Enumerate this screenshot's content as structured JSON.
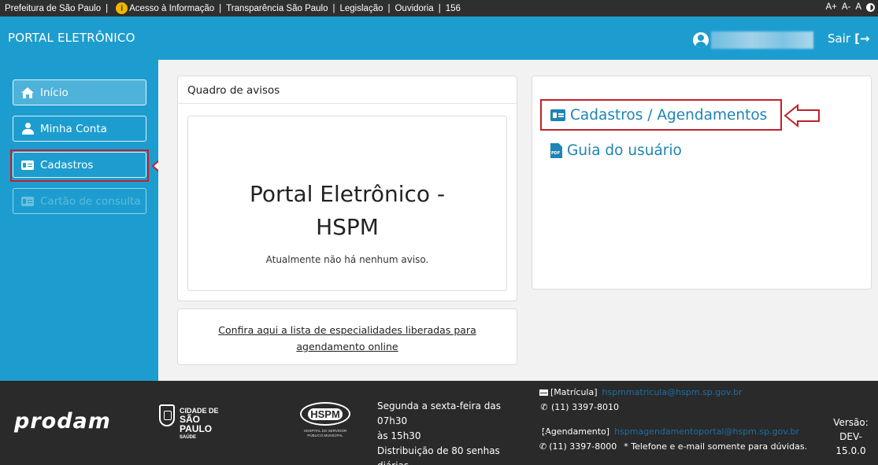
{
  "gov_bar": {
    "items": [
      "Prefeitura de São Paulo",
      "Acesso à Informação",
      "Transparência São Paulo",
      "Legislação",
      "Ouvidoria",
      "156"
    ],
    "font_controls": [
      "A+",
      "A-",
      "A"
    ]
  },
  "header": {
    "brand": "PORTAL ELETRÔNICO",
    "logout": "Sair"
  },
  "sidebar": {
    "items": [
      {
        "label": "Início",
        "icon": "home-icon"
      },
      {
        "label": "Minha Conta",
        "icon": "user-icon"
      },
      {
        "label": "Cadastros",
        "icon": "id-card-icon"
      },
      {
        "label": "Cartão de consulta",
        "icon": "id-card-icon"
      }
    ]
  },
  "notice_board": {
    "title": "Quadro de avisos",
    "heading_line1": "Portal Eletrônico -",
    "heading_line2": "HSPM",
    "message": "Atualmente não há nenhum aviso."
  },
  "specialties": {
    "line1": "Confira aqui a lista de especialidades liberadas para",
    "line2": "agendamento online"
  },
  "links": {
    "cadastros": "Cadastros / Agendamentos",
    "guia": "Guia do usuário"
  },
  "footer": {
    "prodam": "prodam",
    "sp_logo": {
      "line1": "CIDADE DE",
      "line2": "SÃO PAULO",
      "line3": "SAÚDE"
    },
    "hspm_logo": {
      "name": "HSPM",
      "sub": "HOSPITAL DO SERVIDOR PÚBLICO MUNICIPAL"
    },
    "hours": {
      "line1": "Segunda a sexta-feira das 07h30",
      "line2": "às 15h30",
      "line3": "Distribuição de 80 senhas",
      "line4": "diárias"
    },
    "contacts": {
      "matricula_label": "[Matrícula]",
      "matricula_email": "hspmmatricula@hspm.sp.gov.br",
      "matricula_phone": "(11) 3397-8010",
      "agendamento_label": "[Agendamento]",
      "agendamento_email": "hspmagendamentoportal@hspm.sp.gov.br",
      "agendamento_phone": "(11) 3397-8000",
      "note": "* Telefone e e-mail somente para dúvidas."
    },
    "version_label": "Versão:",
    "version_value": "DEV-15.0.0"
  },
  "colors": {
    "primary": "#1d9dcf",
    "link": "#1d84b5",
    "highlight": "#c0212a",
    "footer_bg": "#2a2a2a"
  }
}
